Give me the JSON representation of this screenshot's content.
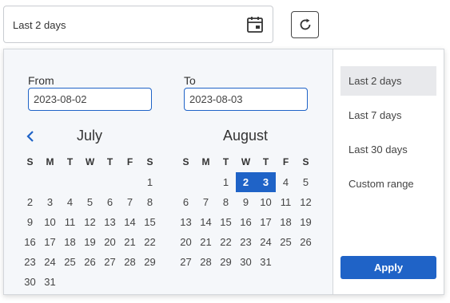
{
  "date_input": {
    "value": "Last 2 days",
    "icon": "calendar-icon"
  },
  "refresh_button": {
    "icon": "refresh-icon"
  },
  "picker": {
    "from": {
      "label": "From",
      "value": "2023-08-02"
    },
    "to": {
      "label": "To",
      "value": "2023-08-03"
    },
    "weekdays": [
      "S",
      "M",
      "T",
      "W",
      "T",
      "F",
      "S"
    ],
    "calendars": [
      {
        "month": "July",
        "first_weekday": 6,
        "days_in_month": 31,
        "selected": []
      },
      {
        "month": "August",
        "first_weekday": 2,
        "days_in_month": 31,
        "selected": [
          2,
          3
        ]
      }
    ],
    "ranges": [
      {
        "label": "Last 2 days",
        "active": true
      },
      {
        "label": "Last 7 days",
        "active": false
      },
      {
        "label": "Last 30 days",
        "active": false
      },
      {
        "label": "Custom range",
        "active": false
      }
    ],
    "apply_label": "Apply"
  },
  "colors": {
    "accent": "#1f63c7",
    "active_option_bg": "#e8e9ec",
    "panel_bg": "#f5f7fa"
  }
}
